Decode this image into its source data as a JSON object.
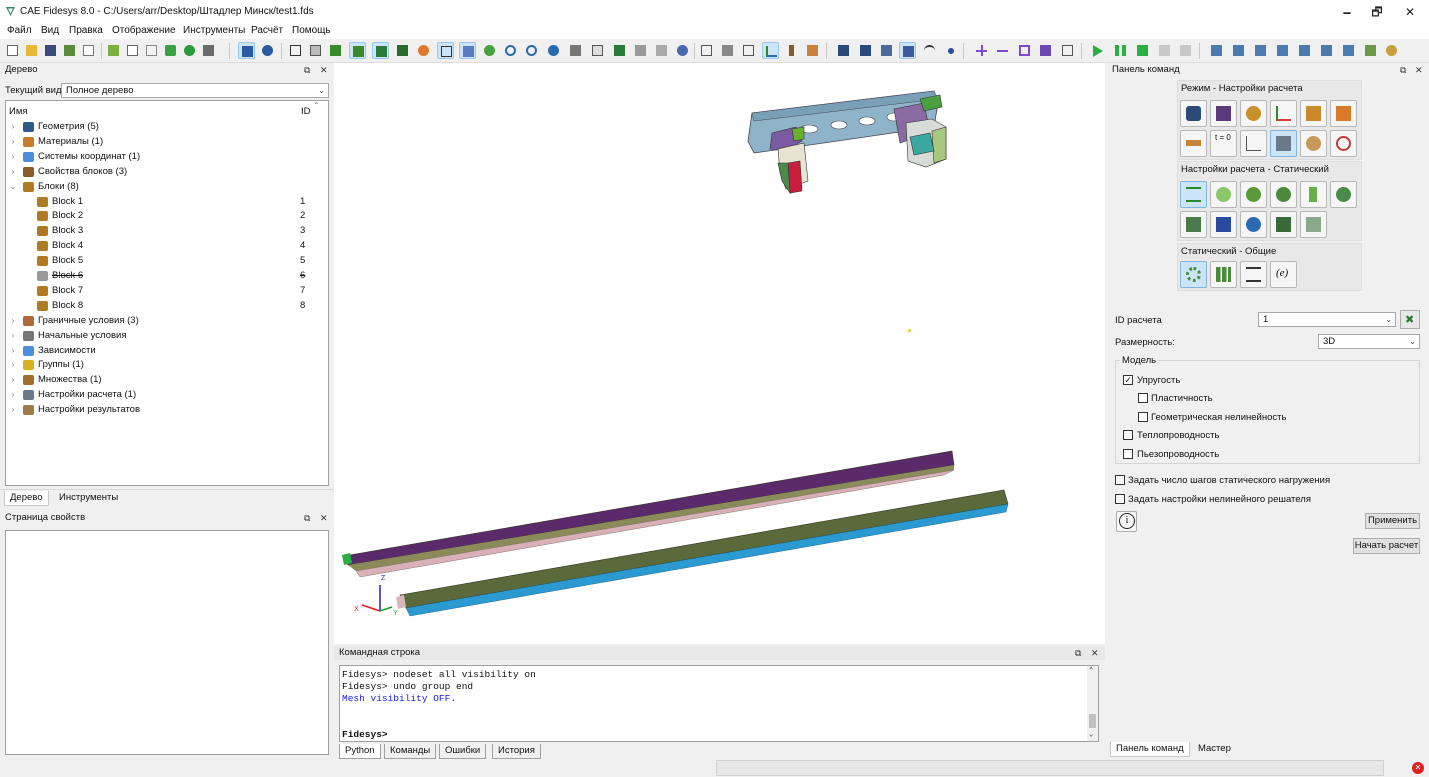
{
  "window": {
    "title": "CAE Fidesys 8.0 - C:/Users/arr/Desktop/Штадлер Минск/test1.fds",
    "minimize": "🗕",
    "maximize": "🗗",
    "close": "✕"
  },
  "menu": [
    "Файл",
    "Вид",
    "Правка",
    "Отображение",
    "Инструменты",
    "Расчёт",
    "Помощь"
  ],
  "tree_panel": {
    "title": "Дерево",
    "current_view_label": "Текущий вид",
    "current_view_value": "Полное дерево",
    "col_name": "Имя",
    "col_id": "ID",
    "items": [
      {
        "label": "Геометрия (5)",
        "id": "",
        "icon": "geometry-icon",
        "color": "#2f5a8a"
      },
      {
        "label": "Материалы (1)",
        "id": "",
        "icon": "materials-icon",
        "color": "#c97b2a"
      },
      {
        "label": "Системы координат (1)",
        "id": "",
        "icon": "coordinate-systems-icon",
        "color": "#4a8fd8"
      },
      {
        "label": "Свойства блоков (3)",
        "id": "",
        "icon": "block-properties-icon",
        "color": "#8a5a2a"
      },
      {
        "label": "Блоки (8)",
        "id": "",
        "icon": "blocks-icon",
        "color": "#b07a22"
      },
      {
        "label": "Block 1",
        "id": "1",
        "icon": "block-icon",
        "color": "#b07a22"
      },
      {
        "label": "Block 2",
        "id": "2",
        "icon": "block-icon",
        "color": "#b07a22"
      },
      {
        "label": "Block 3",
        "id": "3",
        "icon": "block-icon",
        "color": "#b07a22"
      },
      {
        "label": "Block 4",
        "id": "4",
        "icon": "block-icon",
        "color": "#b07a22"
      },
      {
        "label": "Block 5",
        "id": "5",
        "icon": "block-icon",
        "color": "#b07a22"
      },
      {
        "label": "Block 6",
        "id": "6",
        "icon": "block-hidden-icon",
        "color": "#9a9a9a"
      },
      {
        "label": "Block 7",
        "id": "7",
        "icon": "block-icon",
        "color": "#b07a22"
      },
      {
        "label": "Block 8",
        "id": "8",
        "icon": "block-icon",
        "color": "#b07a22"
      },
      {
        "label": "Граничные условия (3)",
        "id": "",
        "icon": "boundary-conditions-icon",
        "color": "#b06a3a"
      },
      {
        "label": "Начальные условия",
        "id": "",
        "icon": "initial-conditions-icon",
        "color": "#777777"
      },
      {
        "label": "Зависимости",
        "id": "",
        "icon": "dependencies-icon",
        "color": "#4a8fd8"
      },
      {
        "label": "Группы (1)",
        "id": "",
        "icon": "groups-icon",
        "color": "#d9b020"
      },
      {
        "label": "Множества (1)",
        "id": "",
        "icon": "sets-icon",
        "color": "#a0702a"
      },
      {
        "label": "Настройки расчета (1)",
        "id": "",
        "icon": "calc-settings-icon",
        "color": "#6a7a8a"
      },
      {
        "label": "Настройки результатов",
        "id": "",
        "icon": "results-settings-icon",
        "color": "#a07a4a"
      }
    ],
    "tabs": [
      "Дерево",
      "Инструменты"
    ]
  },
  "props_panel": {
    "title": "Страница свойств"
  },
  "command_panel": {
    "title": "Командная строка",
    "lines": [
      {
        "text": "Fidesys> nodeset all visibility on",
        "color": "#000000"
      },
      {
        "text": "Fidesys> undo group end",
        "color": "#000000"
      },
      {
        "text": "Mesh visibility OFF.",
        "color": "#1a1aff"
      },
      {
        "text": "",
        "color": "#000000"
      },
      {
        "text": "Fidesys>",
        "color": "#000000"
      }
    ],
    "tabs": [
      "Python",
      "Команды",
      "Ошибки",
      "История"
    ]
  },
  "right_panel": {
    "title": "Панель команд",
    "mode_group_title": "Режим - Настройки расчета",
    "static_group_title": "Настройки расчета - Статический",
    "general_group_title": "Статический - Общие",
    "t0_label": "t = 0",
    "e_label": "(e)",
    "calc_id_label": "ID расчета",
    "calc_id_value": "1",
    "dimension_label": "Размерность:",
    "dimension_value": "3D",
    "model_label": "Модель",
    "options": [
      {
        "label": "Упругость",
        "checked": true
      },
      {
        "label": "Пластичность",
        "checked": false
      },
      {
        "label": "Геометрическая нелинейность",
        "checked": false
      },
      {
        "label": "Теплопроводность",
        "checked": false
      },
      {
        "label": "Пьезопроводность",
        "checked": false
      }
    ],
    "static_steps_label": "Задать число шагов статического нагружения",
    "nonlinear_solver_label": "Задать настройки нелинейного решателя",
    "apply_label": "Применить",
    "start_label": "Начать расчет",
    "tabs": [
      "Панель команд",
      "Мастер"
    ]
  },
  "axes": {
    "x": "X",
    "y": "Y",
    "z": "Z"
  },
  "colors": {
    "accent": "#0078d7",
    "selected_bg": "#cce4f7"
  }
}
